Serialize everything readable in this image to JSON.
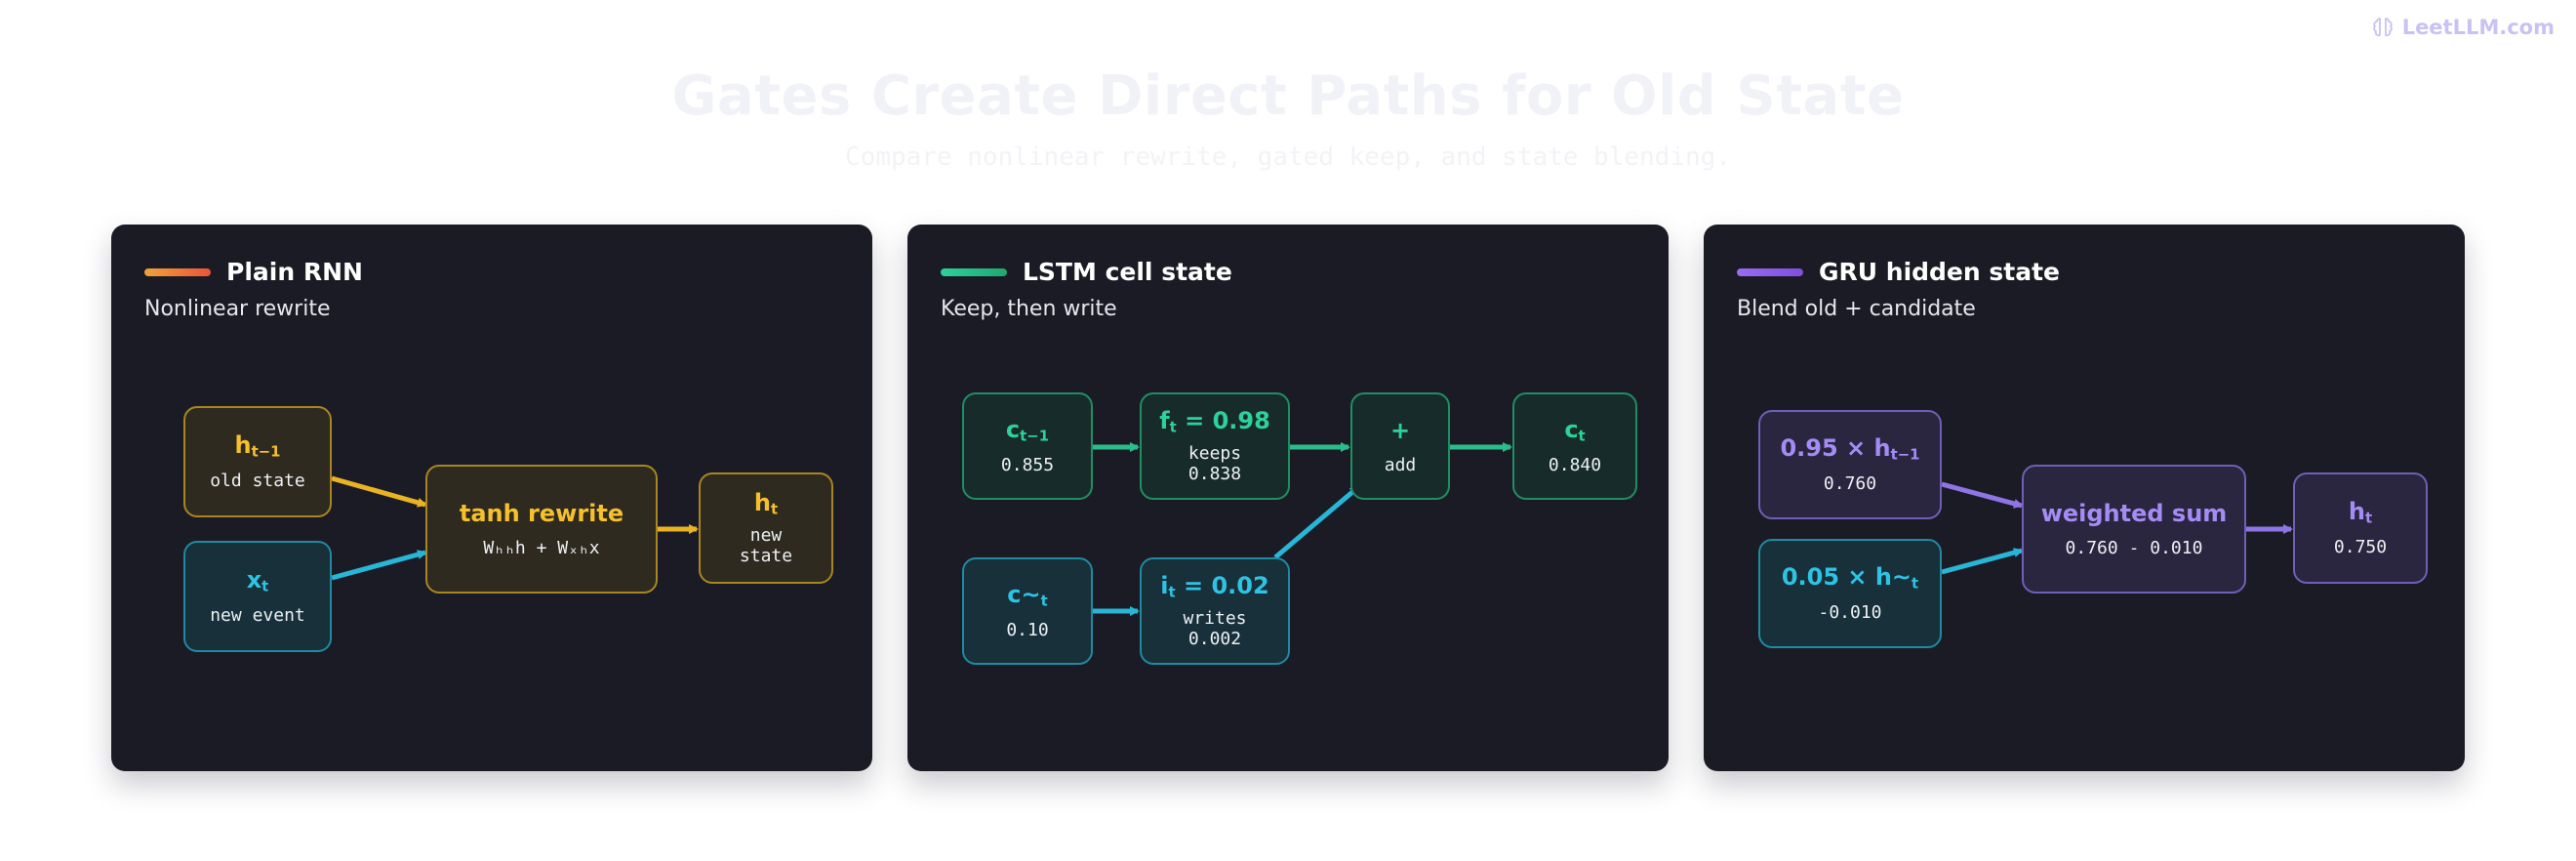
{
  "brand": {
    "name": "LeetLLM.com",
    "icon": "brain-icon",
    "color": "#c9c2f2"
  },
  "header": {
    "title": "Gates Create Direct Paths for Old State",
    "subtitle": "Compare nonlinear rewrite, gated keep, and state blending."
  },
  "panels": [
    {
      "title": "Plain RNN",
      "subtitle": "Nonlinear rewrite",
      "accent": [
        "#f0a23a",
        "#e9553a"
      ],
      "nodes": {
        "h_prev": {
          "label_main": "h",
          "label_sub": "t−1",
          "value": "old state"
        },
        "x": {
          "label_main": "x",
          "label_sub": "t",
          "value": "new event"
        },
        "rewrite": {
          "label": "tanh rewrite",
          "formula": "Wₕₕh + Wₓₕx"
        },
        "h_new": {
          "label_main": "h",
          "label_sub": "t",
          "value": "new\nstate"
        }
      }
    },
    {
      "title": "LSTM cell state",
      "subtitle": "Keep, then write",
      "accent": [
        "#2ed19a",
        "#1fa86f"
      ],
      "nodes": {
        "c_prev": {
          "label_main": "c",
          "label_sub": "t−1",
          "value": "0.855"
        },
        "forget": {
          "label_main": "f",
          "label_sub": "t",
          "label_rest": " = 0.98",
          "value": "keeps\n0.838"
        },
        "add": {
          "label": "+",
          "value": "add"
        },
        "c_new": {
          "label_main": "c",
          "label_sub": "t",
          "value": "0.840"
        },
        "c_cand": {
          "label_main": "c~",
          "label_sub": "t",
          "value": "0.10"
        },
        "input": {
          "label_main": "i",
          "label_sub": "t",
          "label_rest": " = 0.02",
          "value": "writes\n0.002"
        }
      }
    },
    {
      "title": "GRU hidden state",
      "subtitle": "Blend old + candidate",
      "accent": [
        "#9b6cf0",
        "#7e4ee0"
      ],
      "nodes": {
        "keep_old": {
          "label_main": "0.95 × h",
          "label_sub": "t−1",
          "value": "0.760"
        },
        "cand": {
          "label_main": "0.05 × h~",
          "label_sub": "t",
          "value": "-0.010"
        },
        "sum": {
          "label": "weighted sum",
          "value": "0.760 - 0.010"
        },
        "h_new": {
          "label_main": "h",
          "label_sub": "t",
          "value": "0.750"
        }
      }
    }
  ],
  "colors": {
    "yellow": "#f5c02b",
    "teal": "#2ec3e4",
    "green": "#2ed19a",
    "purple": "#a58cf5"
  }
}
